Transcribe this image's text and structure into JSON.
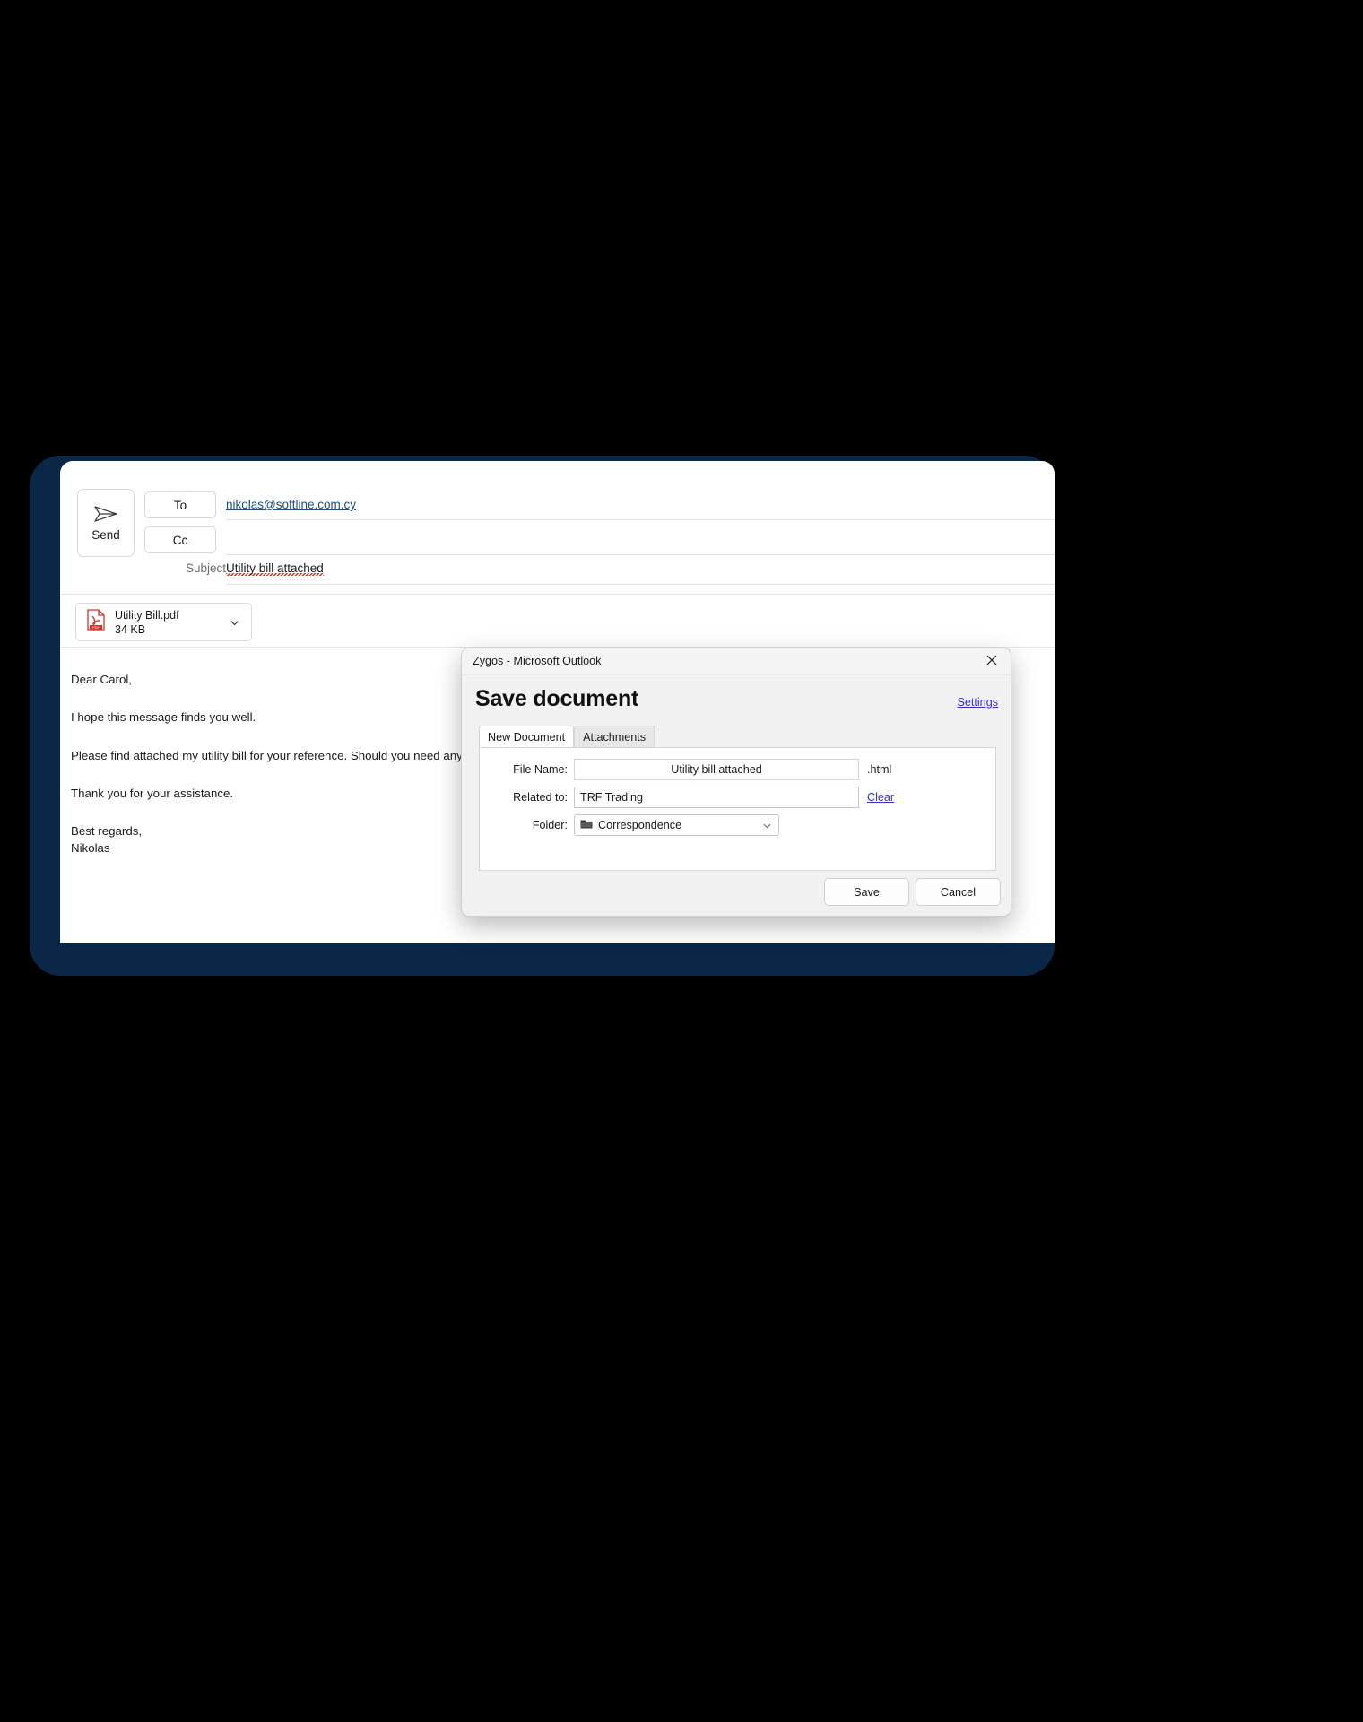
{
  "compose": {
    "send_label": "Send",
    "send_icon": "paper-plane-icon",
    "to_label": "To",
    "cc_label": "Cc",
    "to_value": "nikolas@softline.com.cy",
    "cc_value": "",
    "subject_label": "Subject",
    "subject_value": "Utility bill attached",
    "attachment": {
      "icon": "pdf-file-icon",
      "name": "Utility Bill.pdf",
      "size": "34 KB",
      "chevron_icon": "chevron-down-icon"
    },
    "body": {
      "greeting": "Dear Carol,",
      "paragraph_1": "I hope this message finds you well.",
      "paragraph_2": "Please find attached my utility bill for your reference. Should you need any",
      "paragraph_3": "Thank you for your assistance.",
      "signoff": "Best regards,\nNikolas"
    }
  },
  "dialog": {
    "window_title": "Zygos - Microsoft Outlook",
    "close_icon": "close-icon",
    "heading": "Save document",
    "settings_link": "Settings",
    "tabs": [
      {
        "label": "New Document",
        "active": true
      },
      {
        "label": "Attachments",
        "active": false
      }
    ],
    "fields": {
      "file_name_label": "File Name:",
      "file_name_value": "Utility bill attached",
      "file_extension": ".html",
      "related_to_label": "Related to:",
      "related_to_value": "TRF Trading",
      "clear_link": "Clear",
      "folder_label": "Folder:",
      "folder_value": "Correspondence",
      "folder_icon": "folder-icon",
      "folder_chevron_icon": "chevron-down-icon"
    },
    "buttons": {
      "save": "Save",
      "cancel": "Cancel"
    }
  },
  "colors": {
    "frame_navy": "#0b2747",
    "link_blue": "#3333cc",
    "recipient_blue": "#1b4d7e",
    "pdf_red": "#d93025",
    "spellcheck_red": "#d93025",
    "dialog_bg": "#f1f1f1"
  }
}
